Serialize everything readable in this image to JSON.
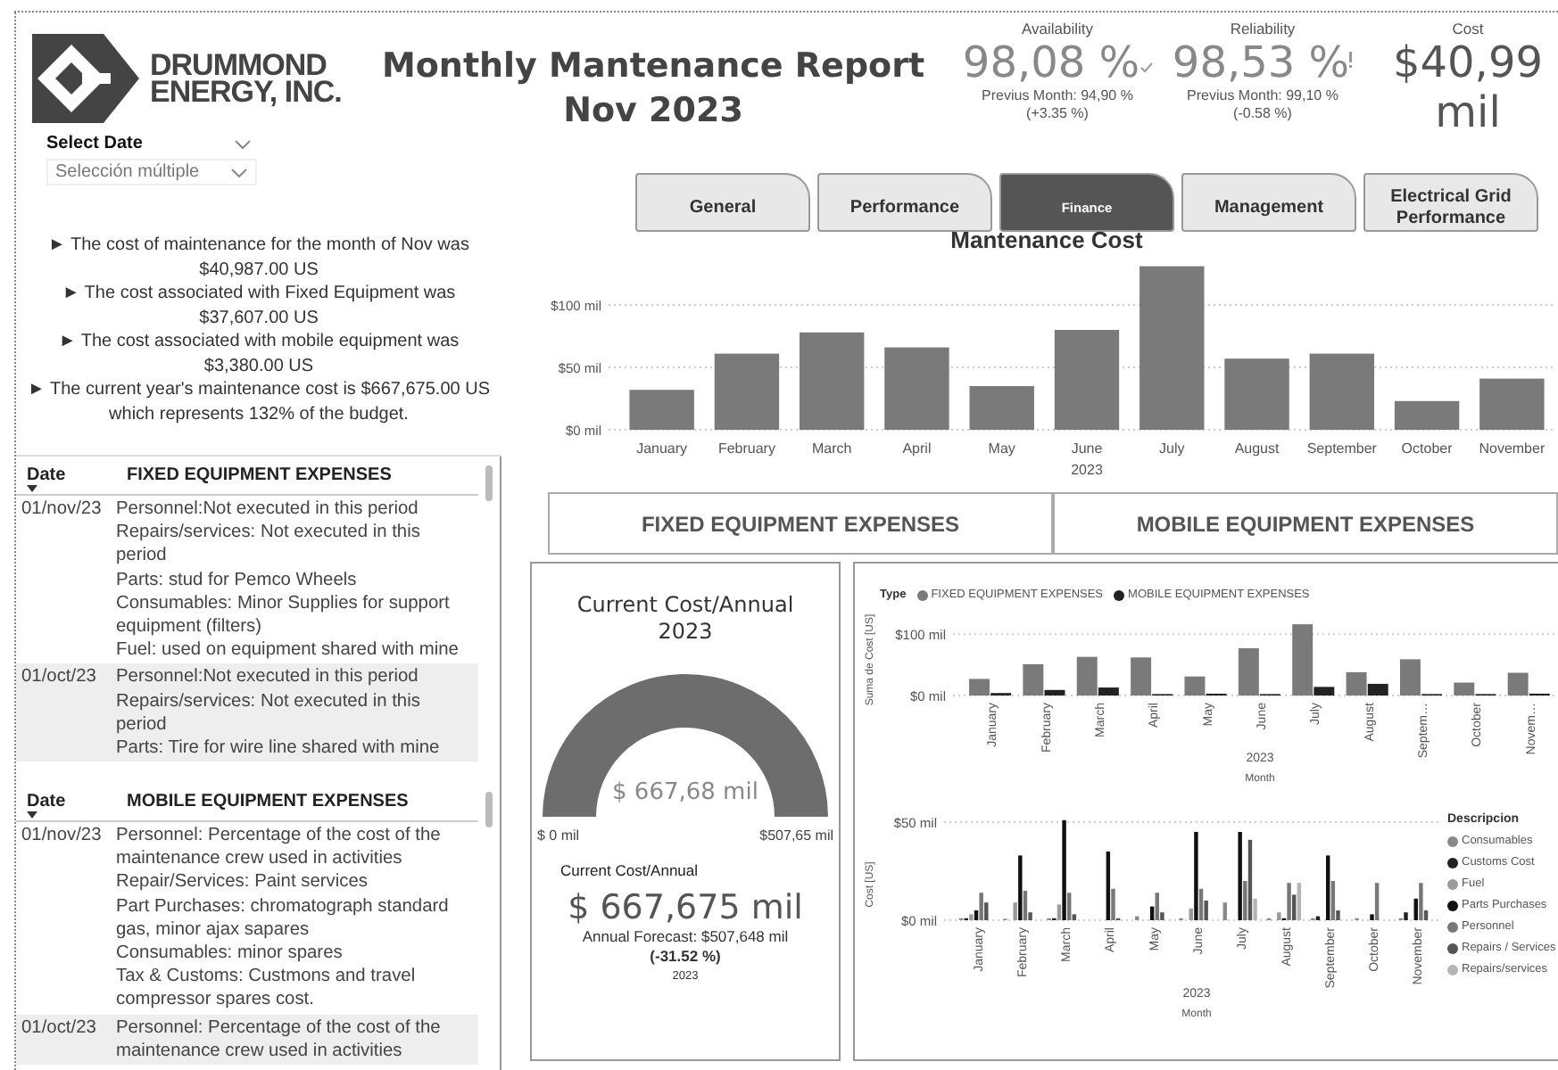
{
  "logo": {
    "line_1": "DRUMMOND",
    "line_2": "ENERGY, INC."
  },
  "title": {
    "line_1": "Monthly Mantenance Report",
    "line_2": "Nov 2023"
  },
  "kpis": [
    {
      "label": "Availability",
      "value": "98,08 %",
      "kind": "check",
      "previous": "Previus Month: 94,90 %",
      "change": "(+3.35 %)"
    },
    {
      "label": "Reliability",
      "value": "98,53 %",
      "kind": "alert",
      "previous": "Previus Month: 99,10 %",
      "change": "(-0.58 %)"
    },
    {
      "label": "Cost",
      "value": "$40,99 mil",
      "kind": "plain"
    }
  ],
  "date_filter": {
    "label": "Select Date",
    "value": "Selección múltiple"
  },
  "tabs": [
    {
      "label": "General",
      "selected": false
    },
    {
      "label": "Performance",
      "selected": false
    },
    {
      "label": "Finance",
      "selected": true
    },
    {
      "label": "Management",
      "selected": false
    },
    {
      "label": "Electrical Grid Performance",
      "selected": false
    }
  ],
  "summary": [
    "► The cost of maintenance for the month of Nov was $40,987.00 US",
    "► The cost associated with Fixed Equipment was $37,607.00 US",
    "► The cost associated with mobile equipment was $3,380.00 US",
    "► The current year's maintenance cost is $667,675.00 US which represents 132% of the budget."
  ],
  "tables": [
    {
      "columns": [
        "Date",
        "FIXED EQUIPMENT EXPENSES"
      ],
      "rows": [
        {
          "date": "01/nov/23",
          "lines": [
            "Personnel:Not executed in this period",
            "Repairs/services: Not executed in this period",
            "Parts: stud for Pemco Wheels",
            "Consumables: Minor Supplies for support equipment (filters)",
            "Fuel: used on equipment shared with mine"
          ]
        },
        {
          "date": "01/oct/23",
          "lines": [
            "Personnel:Not executed in this period",
            "Repairs/services: Not executed in this period",
            "Parts: Tire for wire line shared with mine"
          ]
        }
      ]
    },
    {
      "columns": [
        "Date",
        "MOBILE EQUIPMENT EXPENSES"
      ],
      "rows": [
        {
          "date": "01/nov/23",
          "lines": [
            "Personnel: Percentage of the cost of the maintenance crew used in activities",
            "Repair/Services: Paint services",
            "Part Purchases: chromatograph standard gas, minor ajax sapares",
            "Consumables: minor spares",
            "Tax & Customs: Custmons and travel compressor spares cost."
          ]
        },
        {
          "date": "01/oct/23",
          "lines": [
            "Personnel: Percentage of the cost of the maintenance crew used in activities"
          ]
        }
      ]
    }
  ],
  "cost_chart": {
    "chart_data": {
      "type": "bar",
      "title": "Mantenance Cost",
      "xlabel": "2023",
      "categories": [
        "January",
        "February",
        "March",
        "April",
        "May",
        "June",
        "July",
        "August",
        "September",
        "October",
        "November"
      ],
      "series": [
        {
          "color": "#7a7a7a",
          "values": [
            32,
            61,
            78,
            66,
            35,
            80,
            131,
            57,
            61,
            23,
            41
          ]
        }
      ],
      "ylim": [
        0,
        131
      ],
      "yticks": [
        {
          "value": 0,
          "label": "$0 mil"
        },
        {
          "value": 50,
          "label": "$50 mil"
        },
        {
          "value": 100,
          "label": "$100 mil"
        }
      ]
    }
  },
  "section_buttons": [
    "FIXED EQUIPMENT EXPENSES",
    "MOBILE EQUIPMENT EXPENSES"
  ],
  "gauge": {
    "title": "Current Cost/Annual 2023",
    "value": "$ 667,68 mil",
    "min": "$ 0 mil",
    "max": "$507,65 mil",
    "level": 1
  },
  "annual_card": {
    "label": "Current Cost/Annual",
    "value": "$ 667,675 mil",
    "forecast": "Annual Forecast: $507,648 mil",
    "change": "(-31.52 %)",
    "year": "2023"
  },
  "type_chart": {
    "legend_title": "Type",
    "chart_data": {
      "type": "bar",
      "ylabel": "Suma de Cost [US]",
      "xlabel": "Month",
      "annotations": [
        "2023"
      ],
      "categories": [
        "January",
        "February",
        "March",
        "April",
        "May",
        "June",
        "July",
        "August",
        "Septem…",
        "October",
        "Novem…"
      ],
      "series": [
        {
          "name": "FIXED EQUIPMENT EXPENSES",
          "color": "#7a7a7a",
          "values": [
            27,
            51,
            63,
            62,
            31,
            77,
            116,
            38,
            59,
            21,
            37
          ]
        },
        {
          "name": "MOBILE EQUIPMENT EXPENSES",
          "color": "#222222",
          "values": [
            4,
            9,
            13,
            1,
            3,
            1,
            14,
            19,
            1,
            1,
            3
          ]
        }
      ],
      "ylim": [
        0,
        120
      ],
      "yticks": [
        {
          "value": 0,
          "label": "$0 mil"
        },
        {
          "value": 100,
          "label": "$100 mil"
        }
      ]
    }
  },
  "description_chart": {
    "legend_title": "Descripcion",
    "chart_data": {
      "type": "bar",
      "ylabel": "Cost [US]",
      "xlabel": "Month",
      "annotations": [
        "2023"
      ],
      "categories": [
        "January",
        "February",
        "March",
        "April",
        "May",
        "June",
        "July",
        "August",
        "September",
        "October",
        "November"
      ],
      "series": [
        {
          "name": "Consumables",
          "color": "#8a8a8a",
          "values": [
            1,
            0,
            1,
            null,
            2,
            1,
            9,
            1,
            1,
            1,
            1
          ]
        },
        {
          "name": "Customs Cost",
          "color": "#222222",
          "values": [
            1,
            null,
            1,
            null,
            null,
            null,
            null,
            null,
            2,
            null,
            4
          ]
        },
        {
          "name": "Fuel",
          "color": "#9a9a9a",
          "values": [
            3,
            9,
            8,
            null,
            null,
            6,
            null,
            4,
            null,
            null,
            null
          ]
        },
        {
          "name": "Parts Purchases",
          "color": "#111111",
          "values": [
            5,
            33,
            51,
            35,
            7,
            45,
            45,
            1,
            33,
            3,
            11
          ]
        },
        {
          "name": "Personnel",
          "color": "#777777",
          "values": [
            14,
            15,
            14,
            16,
            14,
            16,
            20,
            19,
            20,
            19,
            19
          ]
        },
        {
          "name": "Repairs / Services",
          "color": "#555555",
          "values": [
            9,
            4,
            3,
            1,
            4,
            10,
            41,
            13,
            5,
            null,
            5
          ]
        },
        {
          "name": "Repairs/services",
          "color": "#b5b5b5",
          "values": [
            null,
            null,
            null,
            null,
            null,
            null,
            11,
            19,
            null,
            null,
            null
          ]
        }
      ],
      "ylim": [
        0,
        51
      ],
      "yticks": [
        {
          "value": 0,
          "label": "$0 mil"
        },
        {
          "value": 50,
          "label": "$50 mil"
        }
      ]
    }
  }
}
